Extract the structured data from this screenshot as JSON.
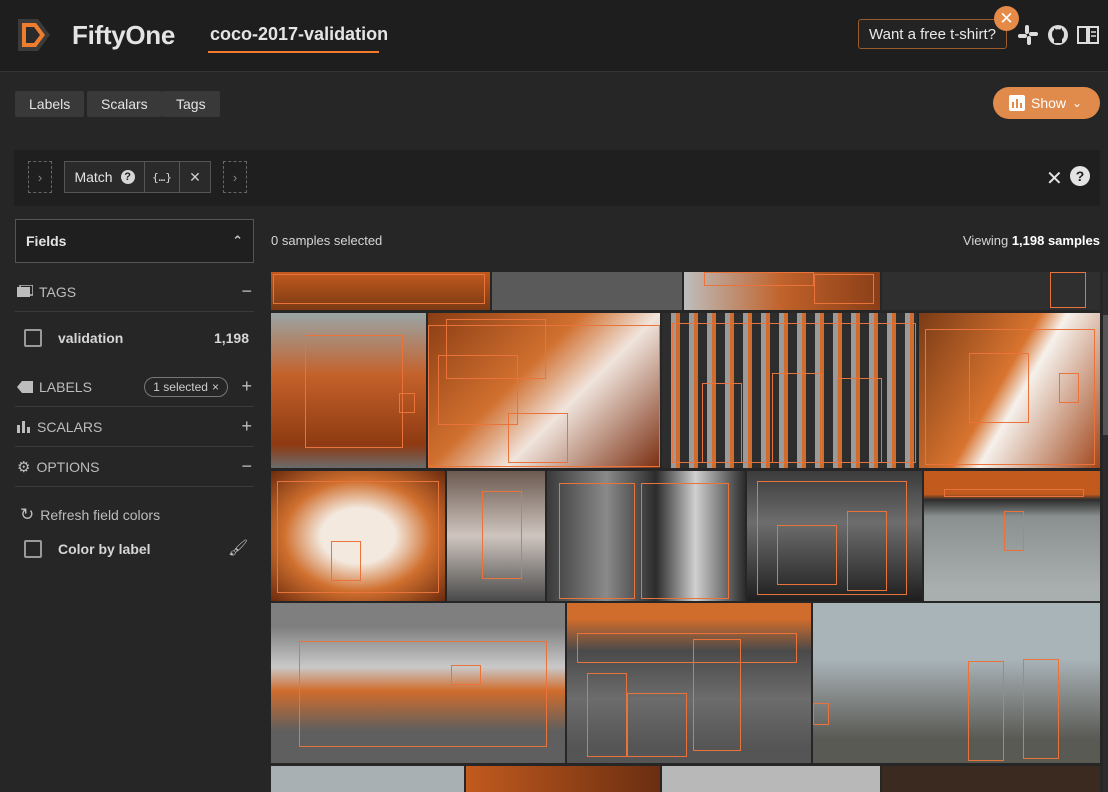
{
  "header": {
    "brand": "FiftyOne",
    "dataset": "coco-2017-validation",
    "tshirt_label": "Want a free t-shirt?",
    "icons": [
      "slack-icon",
      "github-icon",
      "book-icon"
    ]
  },
  "toolbar": {
    "tabs": [
      "Labels",
      "Scalars",
      "Tags"
    ],
    "show_label": "Show"
  },
  "viewbar": {
    "stage_name": "Match",
    "stage_expr": "{…}"
  },
  "sidebar": {
    "fields_label": "Fields",
    "groups": {
      "tags": "TAGS",
      "labels": "LABELS",
      "scalars": "SCALARS",
      "options": "OPTIONS"
    },
    "tag_row": {
      "label": "validation",
      "count": "1,198"
    },
    "labels_selected": "1 selected",
    "refresh_label": "Refresh field colors",
    "color_by_label": "Color by label"
  },
  "grid_info": {
    "selected_text": "0 samples selected",
    "viewing_prefix": "Viewing ",
    "viewing_count": "1,198 samples"
  },
  "colors": {
    "accent": "#f17b29",
    "box": "#e9733a",
    "show_button": "#e08a4c"
  }
}
